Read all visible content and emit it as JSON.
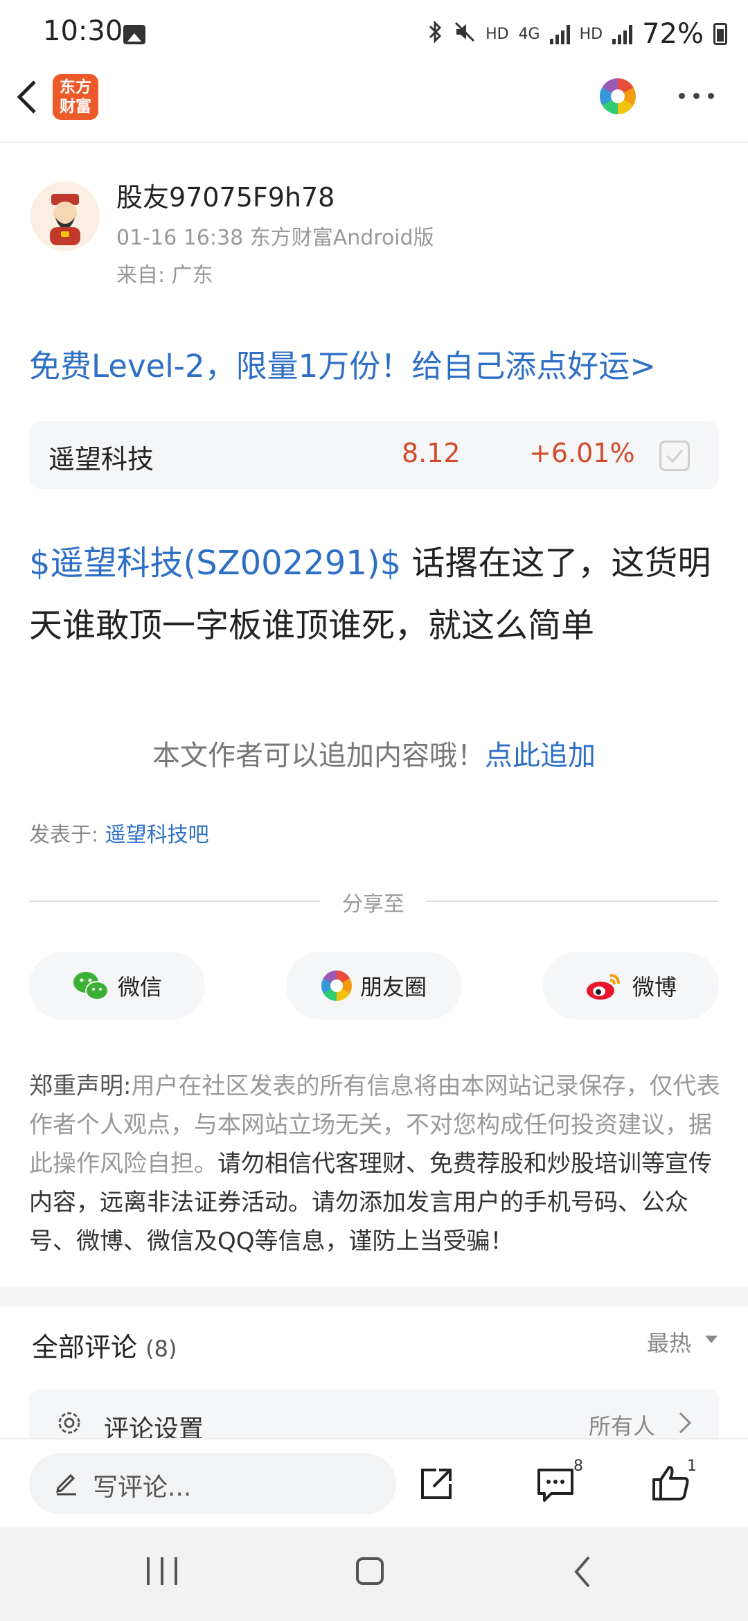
{
  "status_bar": {
    "time": "10:30",
    "battery": "72%",
    "icons": [
      "gallery-icon",
      "bluetooth-icon",
      "mute-icon",
      "hd-icon",
      "4g-icon",
      "signal-icon",
      "hd-icon",
      "signal-icon",
      "battery-icon"
    ],
    "net_hd1": "HD",
    "net_4g": "4G",
    "net_hd2": "HD"
  },
  "topnav": {
    "logo_line1": "东方",
    "logo_line2": "财富"
  },
  "author": {
    "name": "股友97075F9h78",
    "meta": "01-16 16:38 东方财富Android版",
    "location": "来自: 广东"
  },
  "promo": "免费Level-2，限量1万份！给自己添点好运>",
  "stock": {
    "name": "遥望科技",
    "price": "8.12",
    "change": "+6.01%"
  },
  "post": {
    "tag": "$遥望科技(SZ002291)$",
    "body": " 话撂在这了，这货明天谁敢顶一字板谁顶谁死，就这么简单"
  },
  "add_more": {
    "text": "本文作者可以追加内容哦！",
    "link": "点此追加"
  },
  "posted_in": {
    "label": "发表于: ",
    "board": "遥望科技吧"
  },
  "share": {
    "label": "分享至",
    "wechat": "微信",
    "moments": "朋友圈",
    "weibo": "微博"
  },
  "disclaimer": {
    "title": "郑重声明:",
    "part1": "用户在社区发表的所有信息将由本网站记录保存，仅代表作者个人观点，与本网站立场无关，不对您构成任何投资建议，据此操作风险自担。",
    "part2": "请勿相信代客理财、免费荐股和炒股培训等宣传内容，远离非法证券活动。请勿添加发言用户的手机号码、公众号、微博、微信及QQ等信息，谨防上当受骗！"
  },
  "comments": {
    "title": "全部评论",
    "count": "(8)",
    "sort": "最热",
    "settings_label": "评论设置",
    "settings_value": "所有人"
  },
  "bottom_bar": {
    "placeholder": "写评论...",
    "comment_count": "8",
    "like_count": "1"
  },
  "colors": {
    "link_blue": "#2e6fc6",
    "up_red": "#d14b2a",
    "brand_orange": "#ec5a2a"
  }
}
